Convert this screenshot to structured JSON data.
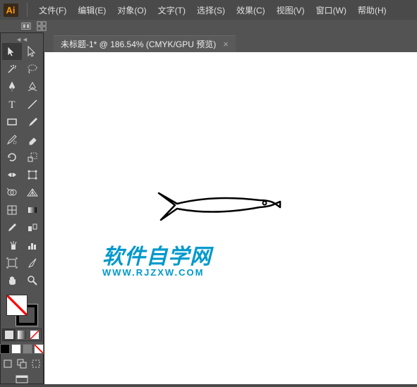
{
  "app": {
    "badge": "Ai"
  },
  "menu": {
    "file": "文件(F)",
    "edit": "编辑(E)",
    "object": "对象(O)",
    "type": "文字(T)",
    "select": "选择(S)",
    "effect": "效果(C)",
    "view": "视图(V)",
    "window": "窗口(W)",
    "help": "帮助(H)"
  },
  "tab": {
    "title": "未标题-1* @ 186.54% (CMYK/GPU 预览)",
    "close": "×"
  },
  "watermark": {
    "main": "软件自学网",
    "url": "WWW.RJZXW.COM"
  },
  "tools": {
    "selection": "selection-tool",
    "direct": "direct-selection-tool",
    "wand": "magic-wand-tool",
    "lasso": "lasso-tool",
    "pen": "pen-tool",
    "curvature": "curvature-tool",
    "type": "type-tool",
    "line": "line-tool",
    "rect": "rectangle-tool",
    "brush": "paintbrush-tool",
    "shaper": "shaper-tool",
    "eraser": "eraser-tool",
    "rotate": "rotate-tool",
    "scale": "scale-tool",
    "width": "width-tool",
    "free": "free-transform-tool",
    "shape-builder": "shape-builder-tool",
    "perspective": "perspective-grid-tool",
    "mesh": "mesh-tool",
    "gradient": "gradient-tool",
    "eyedropper": "eyedropper-tool",
    "blend": "blend-tool",
    "symbol": "symbol-sprayer-tool",
    "graph": "column-graph-tool",
    "artboard": "artboard-tool",
    "slice": "slice-tool",
    "hand": "hand-tool",
    "zoom": "zoom-tool"
  },
  "colors": {
    "fill": "none",
    "stroke": "#000000",
    "swatches": [
      "#000000",
      "#ffffff",
      "#808080",
      "#ff0000"
    ]
  }
}
